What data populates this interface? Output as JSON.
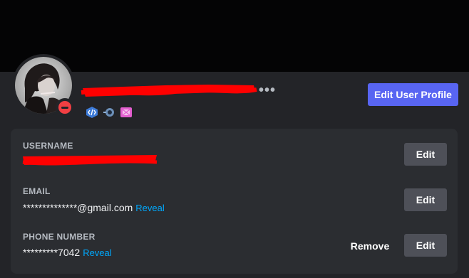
{
  "profile": {
    "edit_profile_label": "Edit User Profile",
    "more_label": "•••",
    "status": "dnd",
    "badges": [
      "active-developer-badge",
      "hypesquad-badge",
      "nitro-badge"
    ]
  },
  "account": {
    "username_label": "USERNAME",
    "email_label": "EMAIL",
    "email_value": "**************@gmail.com",
    "email_reveal": "Reveal",
    "phone_label": "PHONE NUMBER",
    "phone_value": "*********7042",
    "phone_reveal": "Reveal",
    "edit_label": "Edit",
    "remove_label": "Remove"
  },
  "colors": {
    "accent": "#5865f2",
    "link": "#00a8fc",
    "dnd": "#f23f43",
    "redaction": "#ff0000"
  }
}
